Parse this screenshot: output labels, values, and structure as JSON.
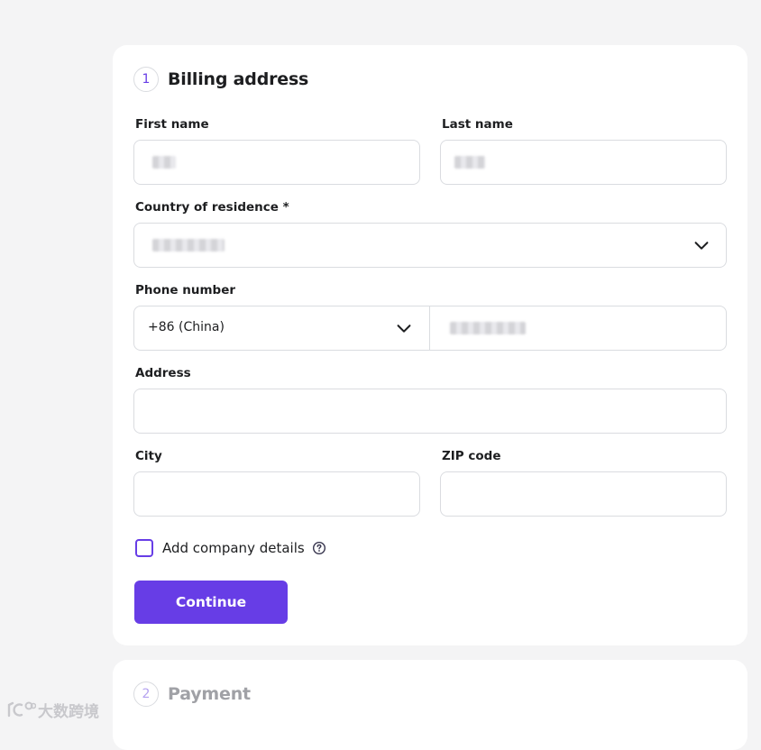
{
  "billing": {
    "step_number": "1",
    "title": "Billing address",
    "fields": {
      "first_name_label": "First name",
      "last_name_label": "Last name",
      "country_label": "Country of residence *",
      "phone_label": "Phone number",
      "phone_code": "+86 (China)",
      "address_label": "Address",
      "city_label": "City",
      "zip_label": "ZIP code"
    },
    "company_checkbox_label": "Add company details",
    "continue_label": "Continue"
  },
  "payment": {
    "step_number": "2",
    "title": "Payment"
  },
  "watermark": {
    "text": "大数跨境"
  },
  "colors": {
    "accent": "#673de6",
    "border": "#dadce0",
    "background": "#f4f4f5"
  },
  "icons": {
    "dropdown": "chevron-down-icon",
    "help": "question-circle-icon"
  }
}
